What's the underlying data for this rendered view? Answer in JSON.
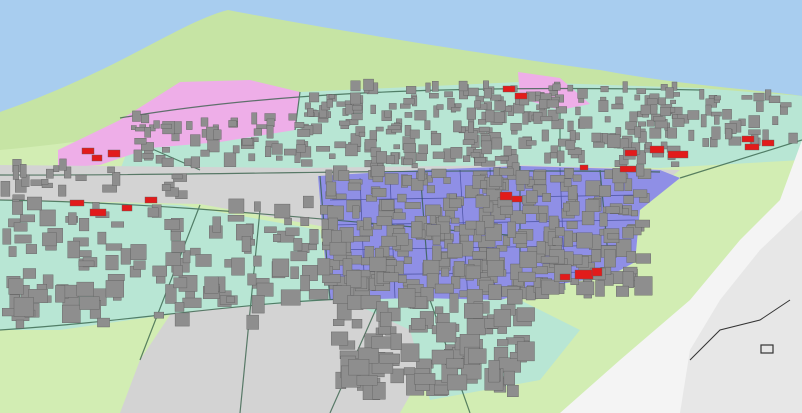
{
  "view": {
    "kind": "3D city zoning map",
    "sky_color": "#a8cdef",
    "terrain_color": "#cfeaad",
    "hill_color": "#c6e4a4"
  },
  "zones": [
    {
      "id": "residential",
      "color": "#b8e6d4"
    },
    {
      "id": "commercial-center",
      "color": "#8f8fe6"
    },
    {
      "id": "mixed-use",
      "color": "#eeaee8"
    },
    {
      "id": "industrial-road",
      "color": "#d3d3d3"
    },
    {
      "id": "green-space",
      "color": "#d2edb3"
    }
  ],
  "buildings": {
    "regular_color": "#8e8e8e",
    "highlight_color": "#e21b1b"
  },
  "lines": {
    "parcel_color": "#2f5b43",
    "outline_color": "#333333"
  }
}
